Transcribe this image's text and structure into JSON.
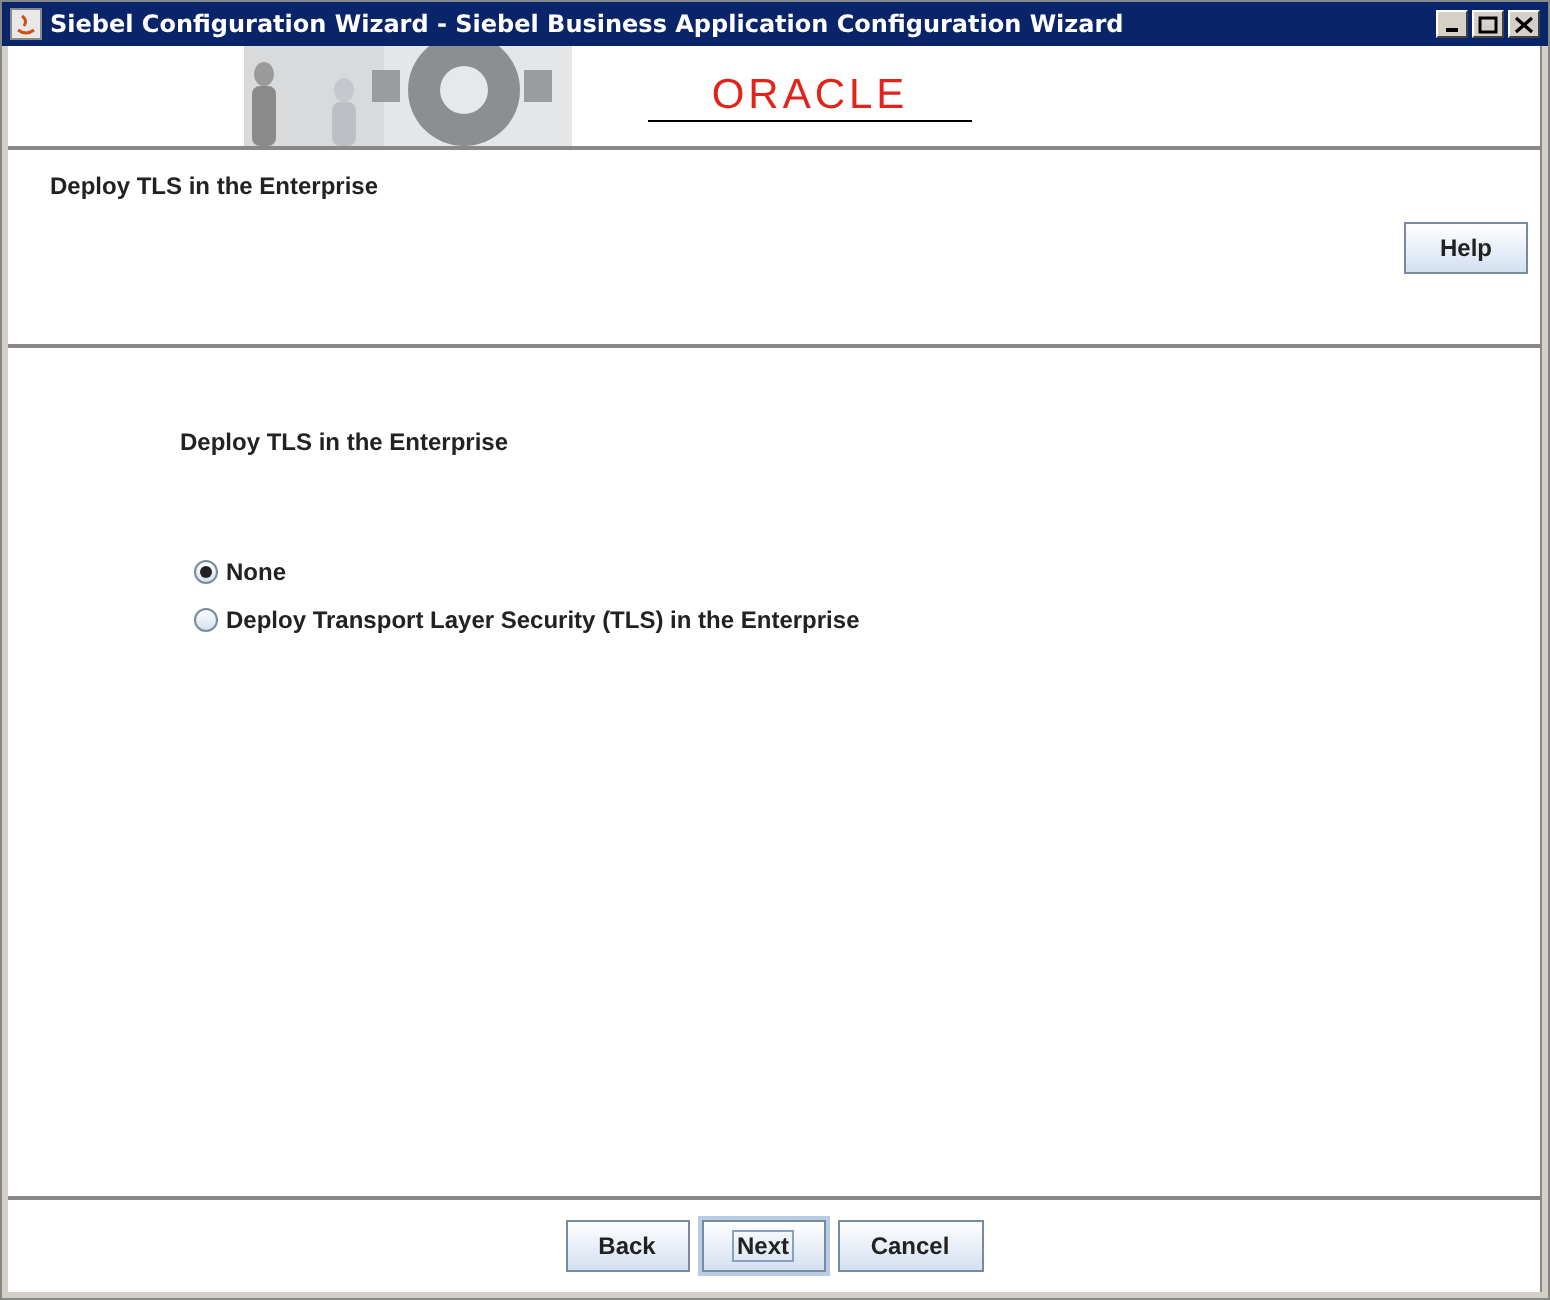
{
  "window": {
    "title": "Siebel Configuration Wizard - Siebel Business Application Configuration Wizard"
  },
  "banner": {
    "logo": "ORACLE"
  },
  "header": {
    "title": "Deploy TLS in the Enterprise",
    "help_button": "Help"
  },
  "content": {
    "heading": "Deploy TLS in the Enterprise",
    "options": [
      {
        "label": "None",
        "selected": true
      },
      {
        "label": "Deploy Transport Layer Security (TLS) in the Enterprise",
        "selected": false
      }
    ]
  },
  "buttons": [
    {
      "label": "Back",
      "focused": false
    },
    {
      "label": "Next",
      "focused": true
    },
    {
      "label": "Cancel",
      "focused": false
    }
  ]
}
